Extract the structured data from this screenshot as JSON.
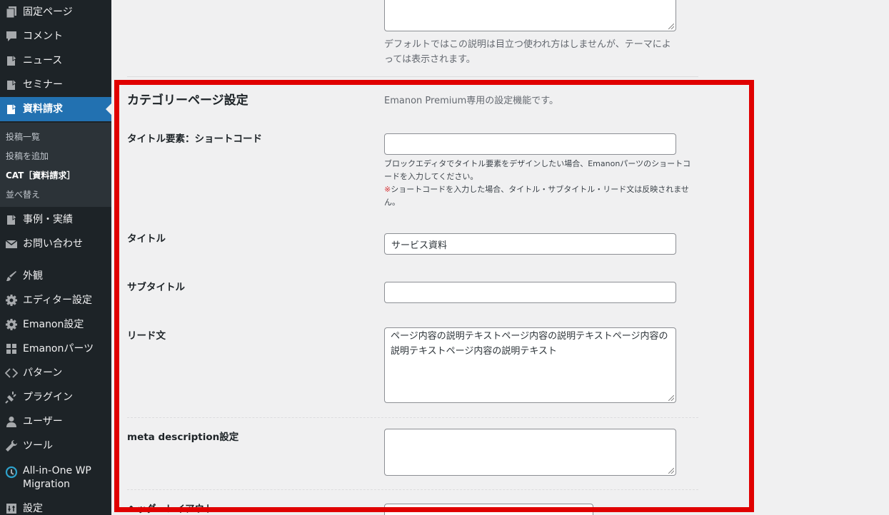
{
  "sidebar": {
    "items": [
      {
        "label": "固定ページ",
        "icon": "pages-icon"
      },
      {
        "label": "コメント",
        "icon": "comment-icon"
      },
      {
        "label": "ニュース",
        "icon": "post-icon"
      },
      {
        "label": "セミナー",
        "icon": "post-icon"
      },
      {
        "label": "資料請求",
        "icon": "post-icon"
      },
      {
        "label": "事例・実績",
        "icon": "post-icon"
      },
      {
        "label": "お問い合わせ",
        "icon": "mail-icon"
      },
      {
        "label": "外観",
        "icon": "brush-icon"
      },
      {
        "label": "エディター設定",
        "icon": "gear-icon"
      },
      {
        "label": "Emanon設定",
        "icon": "gear-icon"
      },
      {
        "label": "Emanonパーツ",
        "icon": "grid-icon"
      },
      {
        "label": "パターン",
        "icon": "diamond-icon"
      },
      {
        "label": "プラグイン",
        "icon": "plug-icon"
      },
      {
        "label": "ユーザー",
        "icon": "user-icon"
      },
      {
        "label": "ツール",
        "icon": "wrench-icon"
      },
      {
        "label": "All-in-One WP Migration",
        "icon": "migration-icon"
      },
      {
        "label": "設定",
        "icon": "settings-icon"
      }
    ],
    "submenu": [
      "投稿一覧",
      "投稿を追加",
      "CAT［資料請求］",
      "並べ替え"
    ]
  },
  "form": {
    "top_description": "デフォルトではこの説明は目立つ使われ方はしませんが、テーマによっては表示されます。",
    "section_title": "カテゴリーページ設定",
    "section_note": "Emanon Premium専用の設定機能です。",
    "shortcode_label": "タイトル要素：ショートコード",
    "shortcode_help_1": "ブロックエディタでタイトル要素をデザインしたい場合、Emanonパーツのショートコードを入力してください。",
    "shortcode_warn_mark": "※",
    "shortcode_help_2": "ショートコードを入力した場合、タイトル・サブタイトル・リード文は反映されません。",
    "title_label": "タイトル",
    "title_value": "サービス資料",
    "subtitle_label": "サブタイトル",
    "subtitle_value": "",
    "lead_label": "リード文",
    "lead_value": "ページ内容の説明テキストページ内容の説明テキストページ内容の説明テキストページ内容の説明テキスト",
    "meta_label": "meta description設定",
    "header_layout_label": "ヘッダーレイアウト"
  },
  "colors": {
    "sidebar_bg": "#1d2327",
    "active_bg": "#2271b1",
    "highlight": "#e00000"
  }
}
